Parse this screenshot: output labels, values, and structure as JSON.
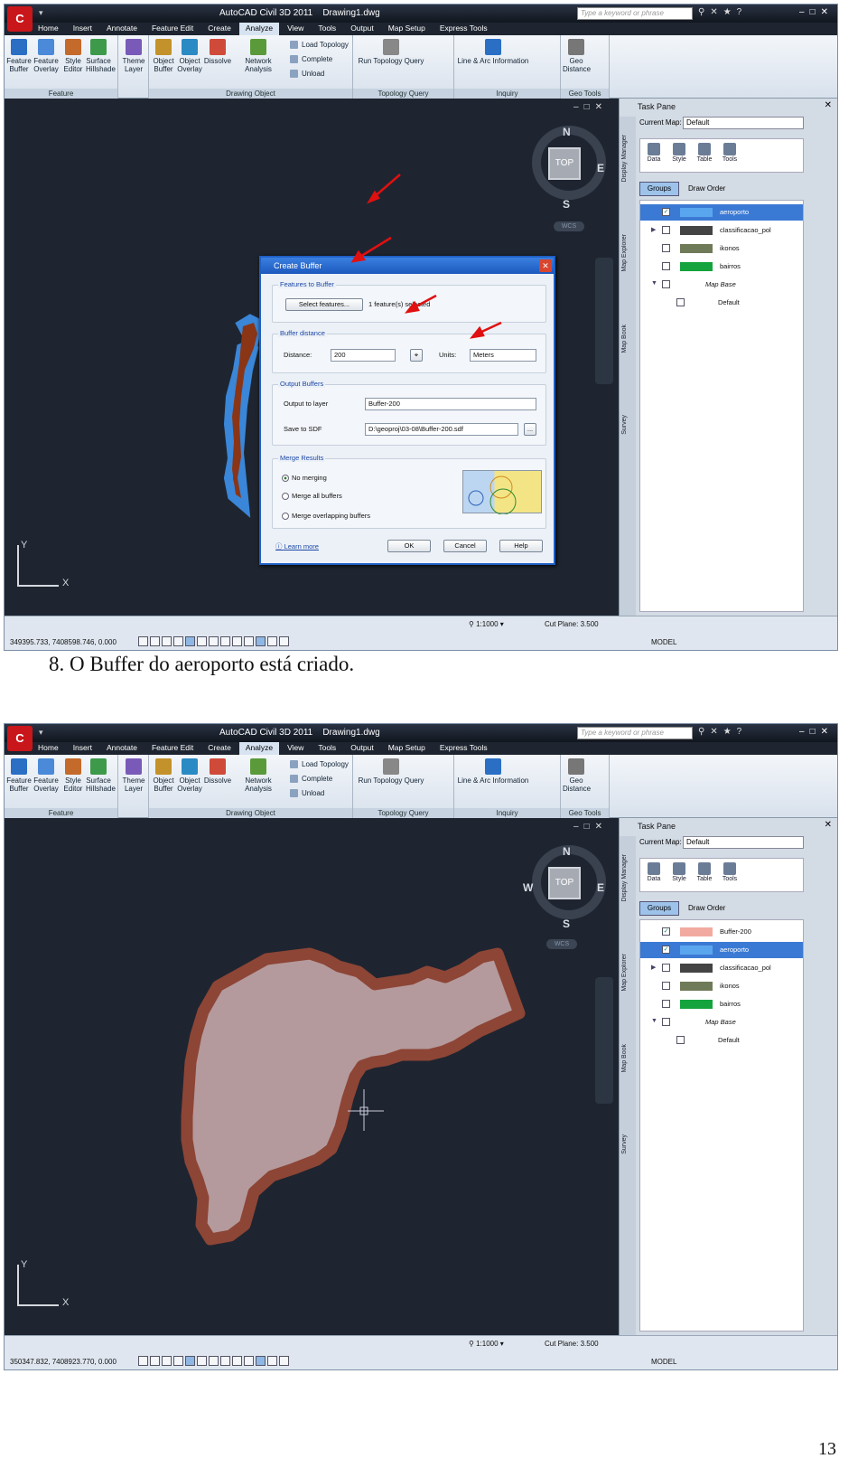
{
  "app": {
    "title": "AutoCAD Civil 3D 2011",
    "file": "Drawing1.dwg",
    "search_placeholder": "Type a keyword or phrase",
    "menu_top": [
      "Home",
      "Insert",
      "Annotate",
      "Feature Edit",
      "Create",
      "Analyze",
      "View",
      "Tools",
      "Output",
      "Map Setup",
      "Express Tools"
    ],
    "menu_bottom": [
      "Home",
      "Insert",
      "Annotate",
      "Feature Edit",
      "Create",
      "Analyze",
      "View",
      "Tools",
      "Output",
      "Map Setup",
      "Express Tools"
    ],
    "active_menu": "Analyze"
  },
  "ribbon": {
    "feature_items": [
      "Feature Buffer",
      "Feature Overlay",
      "Style Editor",
      "Surface Hillshade",
      "Theme Layer"
    ],
    "feature_title": "Feature",
    "drawing_items": [
      "Object Buffer",
      "Object Overlay",
      "Dissolve",
      "Network Analysis"
    ],
    "drawing_small": [
      "Load Topology",
      "Complete",
      "Unload"
    ],
    "drawing_title": "Drawing Object",
    "topology_item": "Run Topology Query",
    "topology_title": "Topology Query",
    "inquiry_item": "Line & Arc Information",
    "inquiry_title": "Inquiry",
    "geo_item": "Geo Distance",
    "geo_title": "Geo Tools"
  },
  "viewcube": {
    "n": "N",
    "e": "E",
    "s": "S",
    "w": "W",
    "top": "TOP",
    "wcs": "WCS"
  },
  "ucs": {
    "x": "X",
    "y": "Y"
  },
  "taskpane": {
    "title": "Task Pane",
    "current_map_label": "Current Map:",
    "current_map_value": "Default",
    "tools": [
      "Data",
      "Style",
      "Table",
      "Tools"
    ],
    "groups_label": "Groups",
    "draw_order_label": "Draw Order",
    "vtabs": [
      "Display Manager",
      "Map Explorer",
      "Map Book",
      "Survey"
    ]
  },
  "layers_top": [
    {
      "name": "aeroporto",
      "selected": true,
      "checked": true,
      "color": "#5aa6ee"
    },
    {
      "name": "classificacao_pol",
      "selected": false,
      "checked": false,
      "color": "#444444"
    },
    {
      "name": "ikonos",
      "selected": false,
      "checked": false,
      "color": "#6f7a58"
    },
    {
      "name": "bairros",
      "selected": false,
      "checked": false,
      "color": "#14a33c"
    },
    {
      "name": "Map Base",
      "selected": false,
      "checked": false,
      "color": ""
    },
    {
      "name": "Default",
      "selected": false,
      "checked": false,
      "color": ""
    }
  ],
  "layers_bottom": [
    {
      "name": "Buffer-200",
      "selected": false,
      "checked": true,
      "color": "#f2aaa0"
    },
    {
      "name": "aeroporto",
      "selected": true,
      "checked": true,
      "color": "#5aa6ee"
    },
    {
      "name": "classificacao_pol",
      "selected": false,
      "checked": false,
      "color": "#444444"
    },
    {
      "name": "ikonos",
      "selected": false,
      "checked": false,
      "color": "#6f7a58"
    },
    {
      "name": "bairros",
      "selected": false,
      "checked": false,
      "color": "#14a33c"
    },
    {
      "name": "Map Base",
      "selected": false,
      "checked": false,
      "color": ""
    },
    {
      "name": "Default",
      "selected": false,
      "checked": false,
      "color": ""
    }
  ],
  "dialog": {
    "title": "Create Buffer",
    "features_section": "Features to Buffer",
    "select_button": "Select features...",
    "selected_text": "1 feature(s) selected",
    "distance_section": "Buffer distance",
    "distance_label": "Distance:",
    "distance_value": "200",
    "units_label": "Units:",
    "units_value": "Meters",
    "output_section": "Output Buffers",
    "output_label": "Output to layer",
    "output_value": "Buffer-200",
    "save_label": "Save to SDF",
    "save_value": "D:\\geoproj\\03-08\\Buffer-200.sdf",
    "browse": "...",
    "merge_section": "Merge Results",
    "merge_options": [
      "No merging",
      "Merge all buffers",
      "Merge overlapping buffers"
    ],
    "learn_more": "Learn more",
    "ok": "OK",
    "cancel": "Cancel",
    "help": "Help"
  },
  "status_top": {
    "coords": "349395.733, 7408598.746, 0.000",
    "scale": "1:1000",
    "cut_plane": "Cut Plane: 3.500",
    "model": "MODEL"
  },
  "status_bottom": {
    "coords": "350347.832, 7408923.770, 0.000",
    "scale": "1:1000",
    "cut_plane": "Cut Plane: 3.500",
    "model": "MODEL"
  },
  "caption": "8.   O Buffer do aeroporto está criado.",
  "page_number": "13",
  "colors": {
    "accent": "#3b7ad4",
    "buffer_fill": "#b49a9c",
    "buffer_stroke": "#8d4536",
    "airport": "#8a3516",
    "airport_edge": "#3a86d8"
  }
}
